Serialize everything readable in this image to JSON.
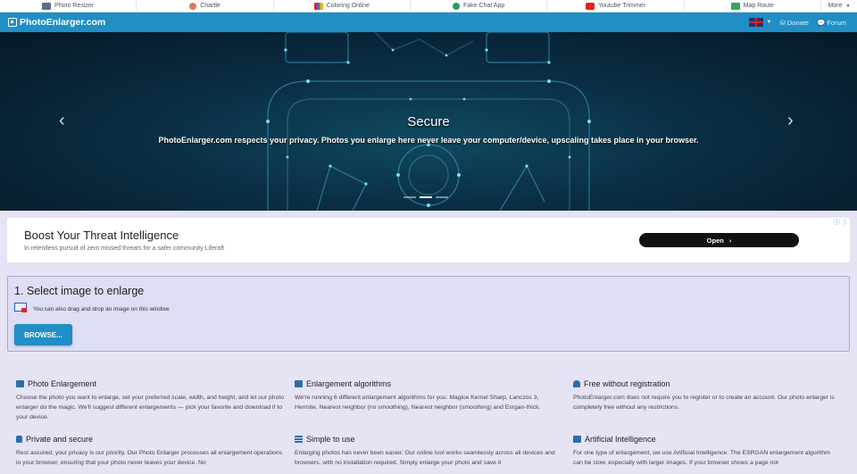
{
  "topbar": {
    "sites": [
      {
        "label": "Photo Resizer",
        "icon": "photo-resizer-icon",
        "color": "#5a6e8c"
      },
      {
        "label": "Chartle",
        "icon": "chartle-icon",
        "color": "#e07b4c"
      },
      {
        "label": "Coloring Online",
        "icon": "coloring-online-icon",
        "color": "#3b6fd6"
      },
      {
        "label": "Fake Chat App",
        "icon": "fake-chat-app-icon",
        "color": "#25a35a"
      },
      {
        "label": "Youtube Trimmer",
        "icon": "youtube-trimmer-icon",
        "color": "#e62117"
      },
      {
        "label": "Map Route",
        "icon": "map-route-icon",
        "color": "#3aa65a"
      }
    ],
    "more_label": "More"
  },
  "navbar": {
    "brand": "PhotoEnlarger.com",
    "donate_label": "Donate",
    "forum_label": "Forum",
    "language_icon": "uk-flag-icon"
  },
  "hero": {
    "title": "Secure",
    "text": "PhotoEnlarger.com respects your privacy. Photos you enlarge here never leave your computer/device, upscaling takes place in your browser.",
    "prev_label": "‹",
    "next_label": "›"
  },
  "ad": {
    "title": "Boost Your Threat Intelligence",
    "subtitle": "In relentless pursuit of zero missed threats for a safer community Liferaft",
    "button_label": "Open",
    "info_label": "ⓘ ⋮"
  },
  "select_panel": {
    "heading": "1. Select image to enlarge",
    "drag_hint": "You can also drag and drop an image on this window.",
    "browse_label": "BROWSE..."
  },
  "features": [
    {
      "title": "Photo Enlargement",
      "icon": "image-icon",
      "text": "Choose the photo you want to enlarge, set your preferred scale, width, and height, and let our photo enlarger do the magic. We'll suggest different enlargements — pick your favorite and download it to your device."
    },
    {
      "title": "Enlargement algorithms",
      "icon": "image-icon",
      "text": "We're running 6 different enlargement algorithms for you: Magice Kernel Sharp, Lanczos 3, Hermite, Nearest neighbor (no smoothing), Nearest neighbor (smoothing) and Esrgan-thick."
    },
    {
      "title": "Free without registration",
      "icon": "user-icon",
      "text": "PhotoEnlarger.com does not require you to register or to create an account. Our photo enlarger is completely free without any restrictions."
    },
    {
      "title": "Private and secure",
      "icon": "lock-icon",
      "text": "Rest assured, your privacy is our priority. Our Photo Enlarger processes all enlargement operations in your browser, ensuring that your photo never leaves your device. No"
    },
    {
      "title": "Simple to use",
      "icon": "list-icon",
      "text": "Enlarging photos has never been easier. Our online tool works seamlessly across all devices and browsers, with no installation required. Simply enlarge your photo and save it"
    },
    {
      "title": "Artificial Intelligence",
      "icon": "image-icon",
      "text": "For one type of enlargement, we use Artificial Intelligence. The ESRGAN enlargement algorithm can be slow, especially with larger images. If your browser shows a page not"
    }
  ]
}
